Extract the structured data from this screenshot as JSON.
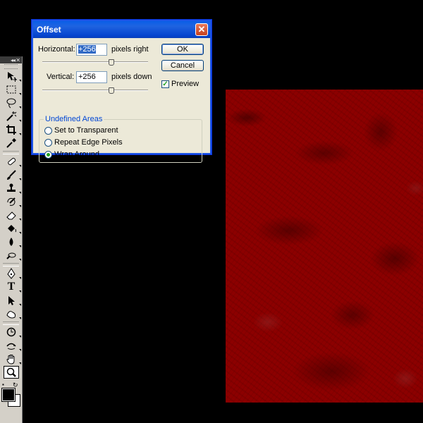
{
  "dialog": {
    "title": "Offset",
    "close_glyph": "✕",
    "horizontal": {
      "label": "Horizontal:",
      "value": "+256",
      "unit": "pixels right",
      "slider_fraction": 0.66
    },
    "vertical": {
      "label": "Vertical:",
      "value": "+256",
      "unit": "pixels down",
      "slider_fraction": 0.66
    },
    "ok_label": "OK",
    "cancel_label": "Cancel",
    "preview": {
      "label": "Preview",
      "checked": true,
      "glyph": "✓"
    },
    "undefined_areas": {
      "title": "Undefined Areas",
      "options": [
        {
          "label": "Set to Transparent",
          "selected": false
        },
        {
          "label": "Repeat Edge Pixels",
          "selected": false
        },
        {
          "label": "Wrap Around",
          "selected": true
        }
      ]
    }
  },
  "toolbox": {
    "header_glyph": "◂◂ ✕",
    "type_tool_glyph": "T",
    "tools": [
      "move",
      "marquee",
      "lasso",
      "magic-wand",
      "crop",
      "eyedropper",
      "healing-brush",
      "brush",
      "clone-stamp",
      "history-brush",
      "eraser",
      "paint-bucket",
      "blur",
      "dodge",
      "pen",
      "type",
      "path-selection",
      "custom-shape",
      "notes",
      "3d-rotate",
      "hand",
      "zoom"
    ],
    "selected_tool": "zoom",
    "colors": {
      "foreground": "#000000",
      "background": "#ffffff"
    }
  },
  "canvas": {
    "base_color": "#8c0000"
  }
}
